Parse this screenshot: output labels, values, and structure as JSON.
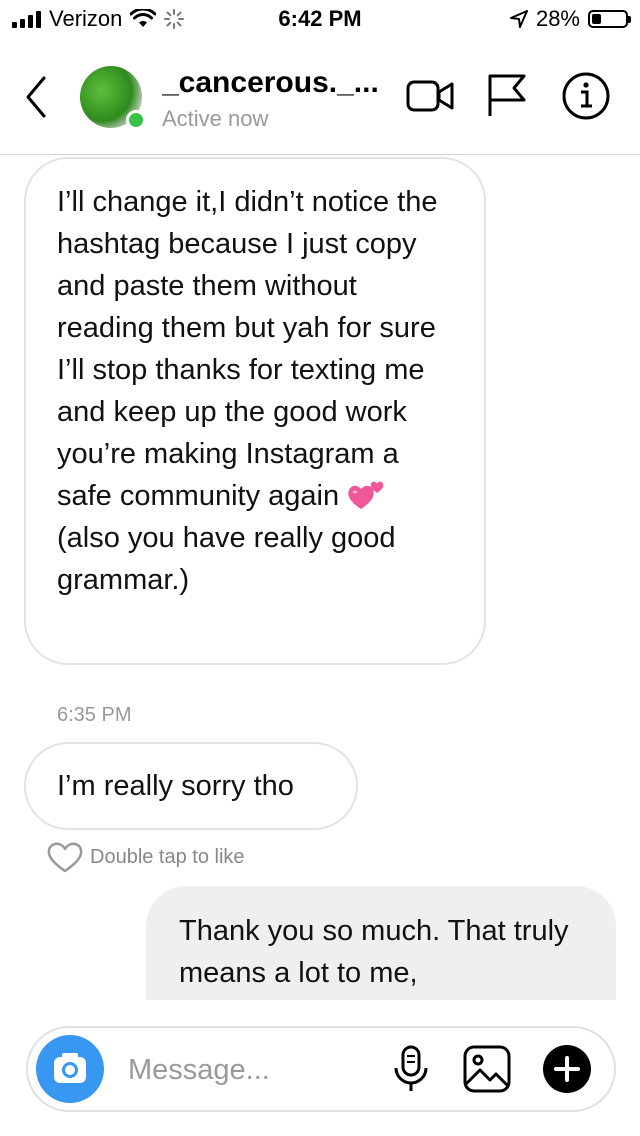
{
  "status_bar": {
    "carrier": "Verizon",
    "time": "6:42 PM",
    "battery_percent": "28%",
    "battery_level": 0.28
  },
  "header": {
    "contact_name": "_cancerous._...",
    "contact_status": "Active now",
    "icons": [
      "back-chevron-icon",
      "video-call-icon",
      "flag-icon",
      "info-icon"
    ]
  },
  "messages": [
    {
      "direction": "incoming",
      "text_before_emoji": "I’ll change it,I didn’t notice the hashtag because I just copy and paste them without reading them but yah for sure I’ll stop thanks for texting me and keep up the good work you’re making Instagram a safe community again",
      "emoji": "two-hearts",
      "text_after_emoji": "(also you have really good grammar.)"
    },
    {
      "direction": "incoming",
      "text": "I’m really sorry tho"
    },
    {
      "direction": "outgoing",
      "text": "Thank you so much. That truly means a lot to me,"
    }
  ],
  "timestamp": "6:35 PM",
  "like_hint": "Double tap to like",
  "composer": {
    "placeholder": "Message...",
    "icons": [
      "camera-icon",
      "microphone-icon",
      "gallery-icon",
      "add-icon"
    ]
  },
  "colors": {
    "accent_blue": "#3897f0",
    "online_green": "#39c24a",
    "bubble_border": "#e3e3e3",
    "outgoing_bubble": "#efefef",
    "heart_pink": "#f0569a"
  }
}
